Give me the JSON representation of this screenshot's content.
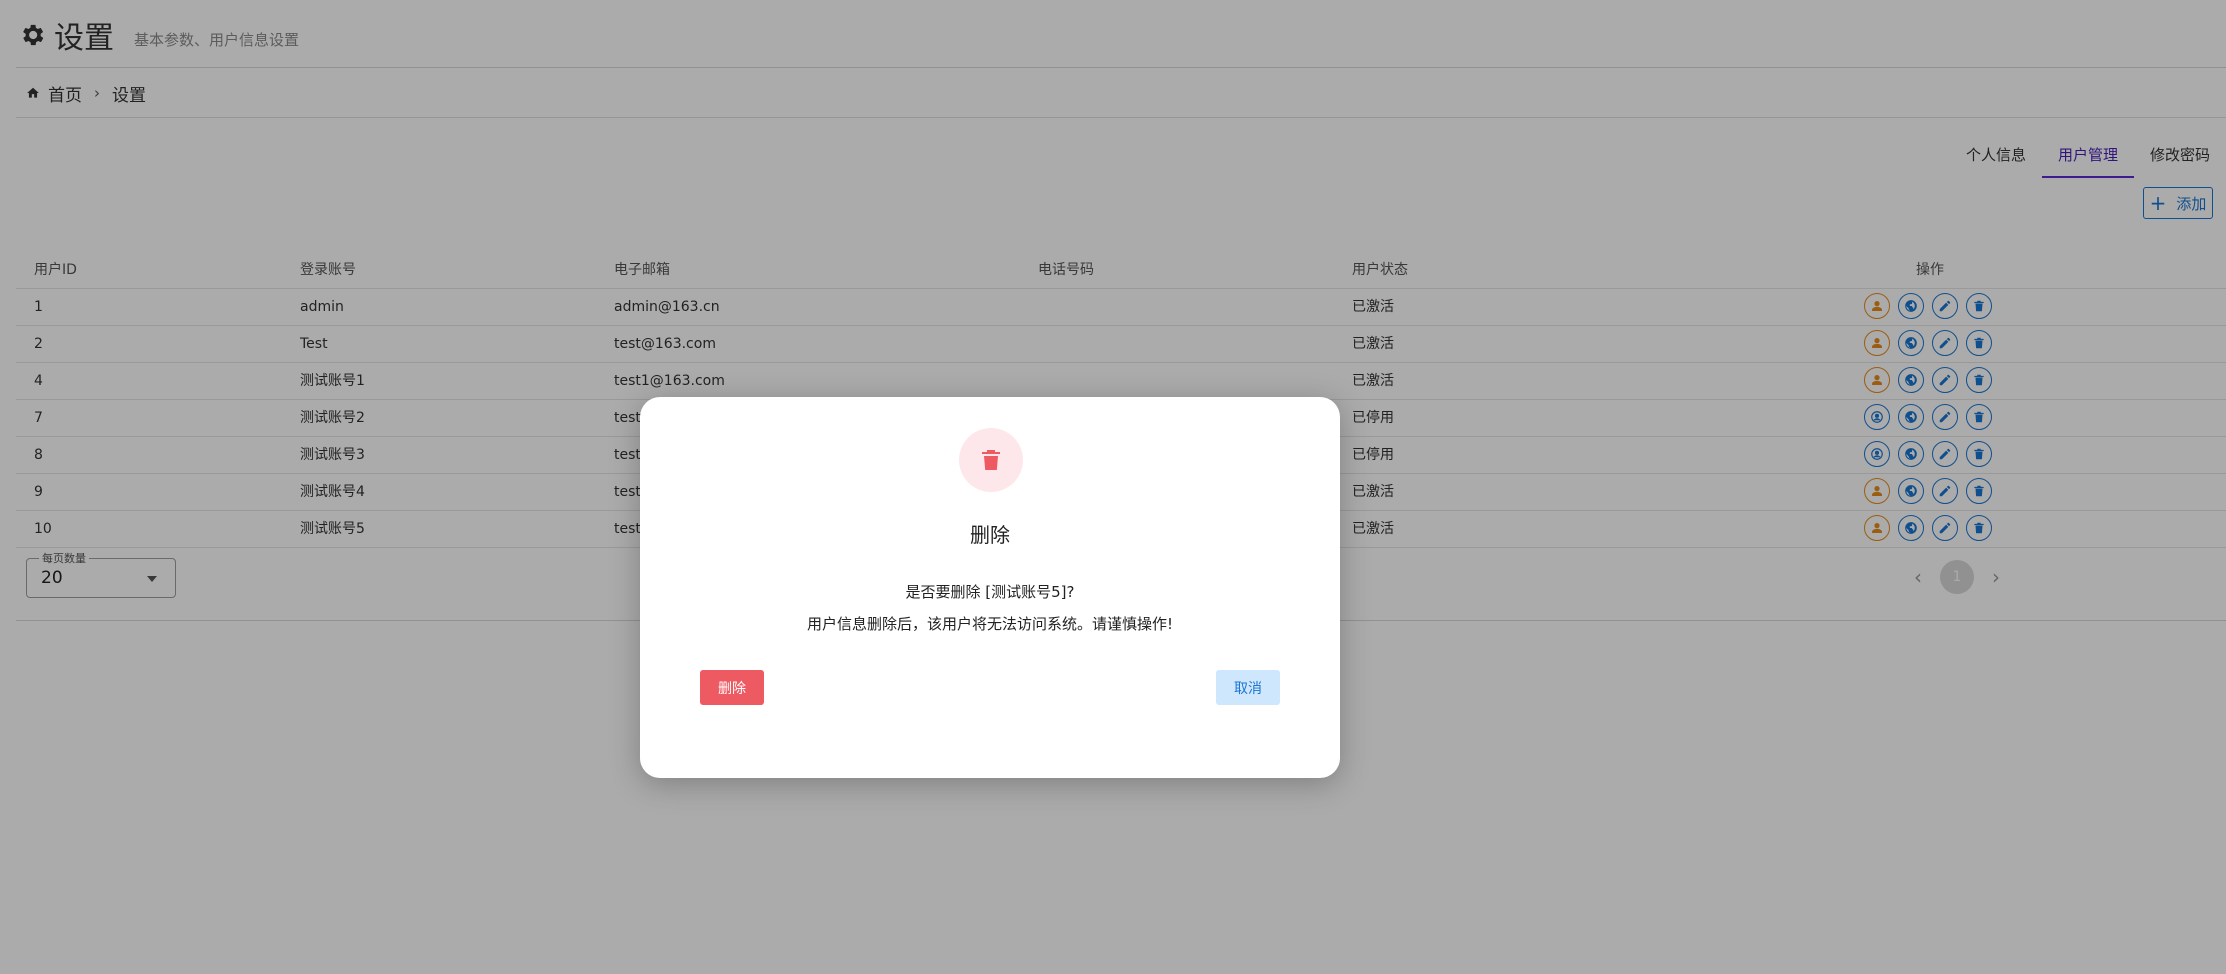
{
  "header": {
    "title": "设置",
    "subtitle": "基本参数、用户信息设置"
  },
  "breadcrumb": {
    "home": "首页",
    "current": "设置"
  },
  "tabs": [
    {
      "label": "个人信息",
      "active": false
    },
    {
      "label": "用户管理",
      "active": true
    },
    {
      "label": "修改密码",
      "active": false
    }
  ],
  "add_button": {
    "label": "添加"
  },
  "table": {
    "columns": [
      "用户ID",
      "登录账号",
      "电子邮箱",
      "电话号码",
      "用户状态",
      "操作"
    ],
    "rows": [
      {
        "id": "1",
        "account": "admin",
        "email": "admin@163.cn",
        "phone": "",
        "status": "已激活"
      },
      {
        "id": "2",
        "account": "Test",
        "email": "test@163.com",
        "phone": "",
        "status": "已激活"
      },
      {
        "id": "4",
        "account": "测试账号1",
        "email": "test1@163.com",
        "phone": "",
        "status": "已激活"
      },
      {
        "id": "7",
        "account": "测试账号2",
        "email": "test",
        "phone": "",
        "status": "已停用"
      },
      {
        "id": "8",
        "account": "测试账号3",
        "email": "test",
        "phone": "",
        "status": "已停用"
      },
      {
        "id": "9",
        "account": "测试账号4",
        "email": "test",
        "phone": "",
        "status": "已激活"
      },
      {
        "id": "10",
        "account": "测试账号5",
        "email": "test",
        "phone": "",
        "status": "已激活"
      }
    ]
  },
  "pagination": {
    "per_page_label": "每页数量",
    "per_page_value": "20",
    "current_page": "1"
  },
  "dialog": {
    "title": "删除",
    "message_line1": "是否要删除 [测试账号5]?",
    "message_line2": "用户信息删除后，该用户将无法访问系统。请谨慎操作!",
    "confirm_label": "删除",
    "cancel_label": "取消"
  },
  "colors": {
    "accent": "#1976d2",
    "danger": "#ee5a62",
    "warning": "#e88b1a",
    "tab_active": "#5a2bd6"
  }
}
